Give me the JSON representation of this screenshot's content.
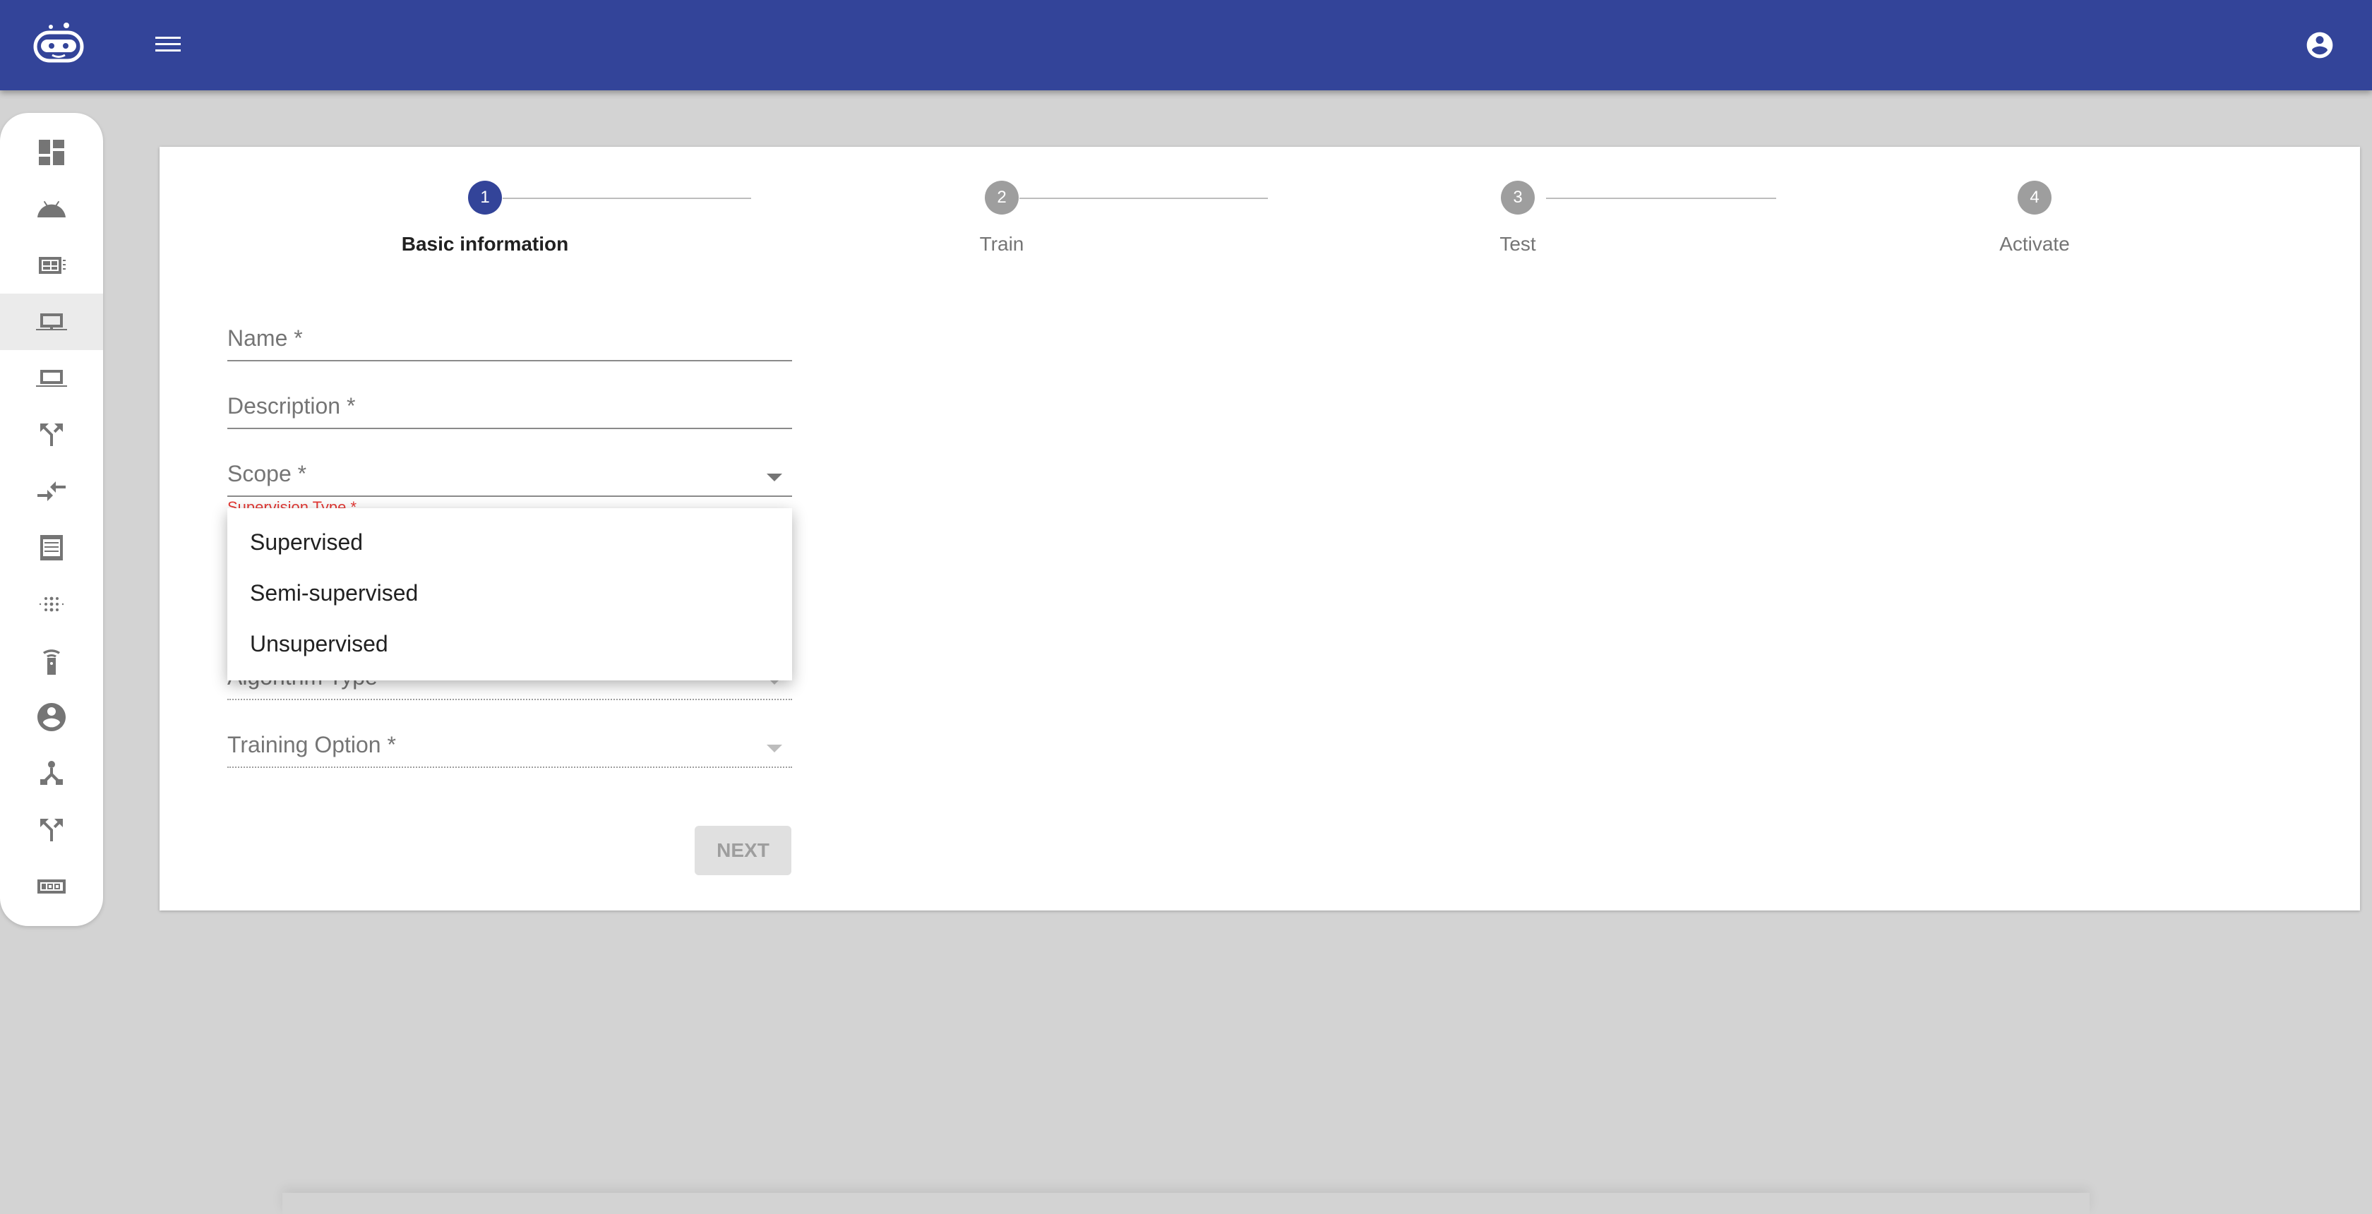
{
  "header": {
    "logo_icon": "robot-face-icon",
    "menu_icon": "hamburger-menu-icon",
    "account_icon": "account-circle-icon",
    "color": "#334499"
  },
  "sidebar": {
    "items": [
      {
        "icon": "dashboard-icon"
      },
      {
        "icon": "android-icon"
      },
      {
        "icon": "chip-icon"
      },
      {
        "icon": "laptop-icon",
        "active": true
      },
      {
        "icon": "laptop-outline-icon"
      },
      {
        "icon": "call-split-icon"
      },
      {
        "icon": "compare-arrows-icon"
      },
      {
        "icon": "receipt-icon"
      },
      {
        "icon": "blur-icon"
      },
      {
        "icon": "remote-icon"
      },
      {
        "icon": "account-circle-icon"
      },
      {
        "icon": "device-hub-icon"
      },
      {
        "icon": "call-split-icon"
      },
      {
        "icon": "counter-icon"
      }
    ]
  },
  "stepper": {
    "steps": [
      {
        "number": "1",
        "label": "Basic information",
        "active": true
      },
      {
        "number": "2",
        "label": "Train"
      },
      {
        "number": "3",
        "label": "Test"
      },
      {
        "number": "4",
        "label": "Activate"
      }
    ]
  },
  "form": {
    "name_label": "Name *",
    "description_label": "Description *",
    "scope_label": "Scope *",
    "supervision_type_label": "Supervision Type *",
    "algorithm_type_label": "Algorithm Type",
    "training_option_label": "Training Option *",
    "next_label": "NEXT"
  },
  "dropdown": {
    "options": [
      "Supervised",
      "Semi-supervised",
      "Unsupervised"
    ]
  },
  "colors": {
    "primary": "#334499",
    "error": "#e53935"
  }
}
